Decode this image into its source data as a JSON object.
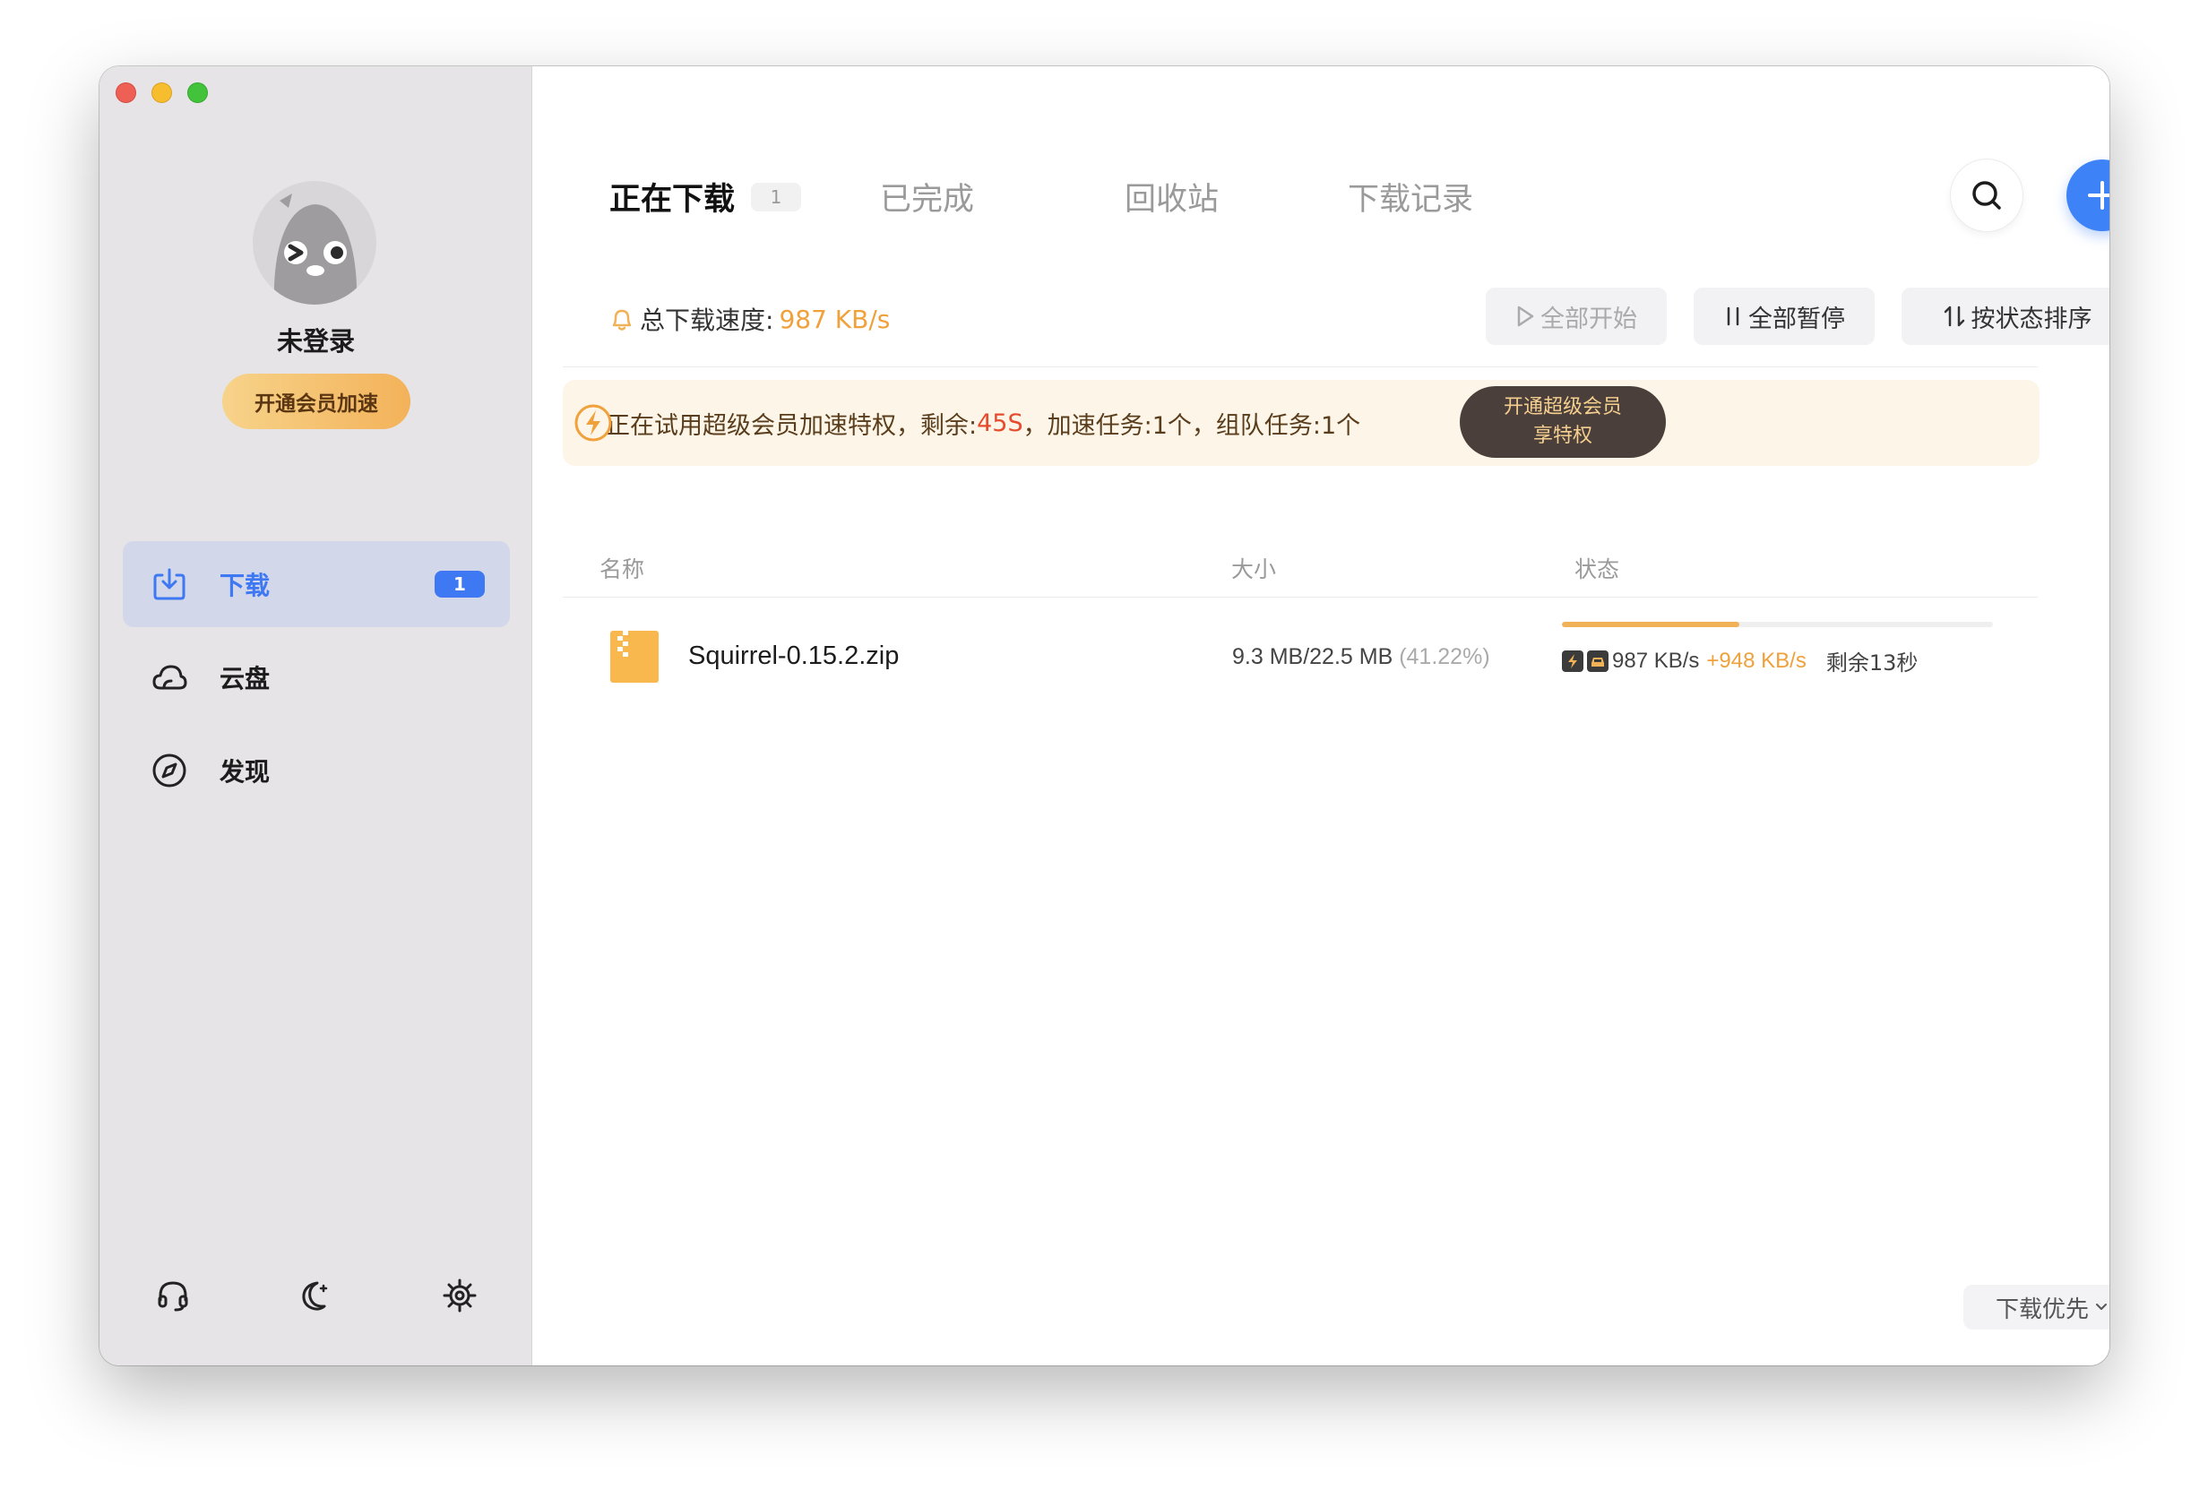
{
  "sidebar": {
    "username": "未登录",
    "vip_button": "开通会员加速",
    "nav": [
      {
        "label": "下载",
        "icon": "download-icon",
        "badge": "1",
        "active": true
      },
      {
        "label": "云盘",
        "icon": "cloud-icon",
        "active": false
      },
      {
        "label": "发现",
        "icon": "compass-icon",
        "active": false
      }
    ],
    "footer_icons": [
      "headset-icon",
      "moon-icon",
      "gear-icon"
    ]
  },
  "tabs": [
    {
      "label": "正在下载",
      "count": "1",
      "active": true
    },
    {
      "label": "已完成",
      "active": false
    },
    {
      "label": "回收站",
      "active": false
    },
    {
      "label": "下载记录",
      "active": false
    }
  ],
  "toolbar": {
    "speed_label": "总下载速度:",
    "speed_value": "987 KB/s",
    "start_all": "全部开始",
    "pause_all": "全部暂停",
    "sort_by_status": "按状态排序"
  },
  "banner": {
    "prefix": "正在试用超级会员加速特权，剩余: ",
    "remaining": "45S",
    "suffix": "，加速任务:1个，组队任务:1个",
    "button_line1": "开通超级会员",
    "button_line2": "享特权"
  },
  "columns": {
    "name": "名称",
    "size": "大小",
    "status": "状态"
  },
  "downloads": [
    {
      "name": "Squirrel-0.15.2.zip",
      "size": "9.3 MB/22.5 MB",
      "percent": "(41.22%)",
      "progress": 0.4122,
      "speed": "987 KB/s",
      "boost": "+948 KB/s",
      "remaining": "剩余13秒"
    }
  ],
  "priority": "下载优先",
  "colors": {
    "accent": "#3e82f7",
    "orange": "#f0a13b",
    "banner_bg": "#fdf5e7"
  }
}
